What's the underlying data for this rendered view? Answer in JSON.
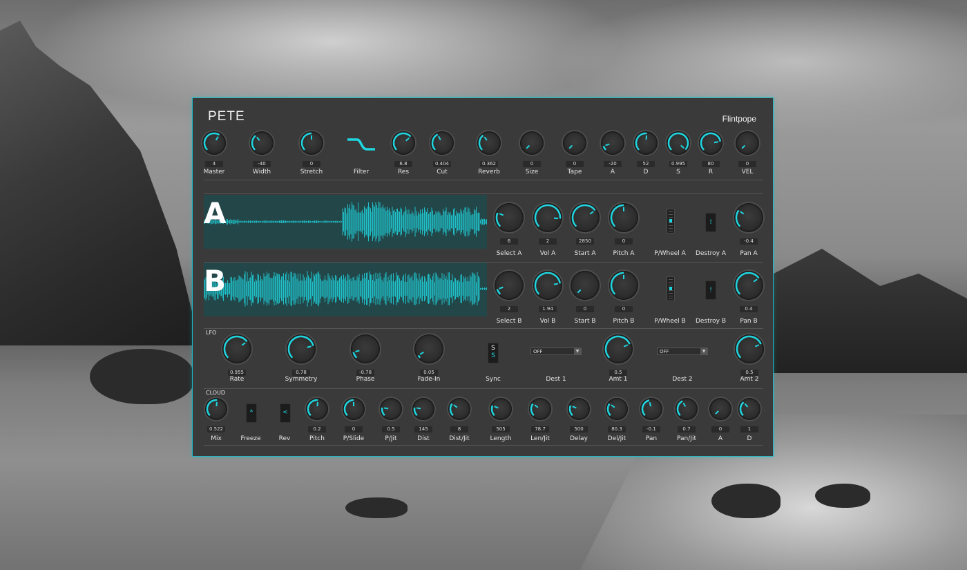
{
  "plugin": {
    "name": "PETE",
    "brand": "Flintpope"
  },
  "colors": {
    "accent": "#1fd6e0",
    "panel": "#3a3a3a"
  },
  "main_row": [
    {
      "id": "master",
      "label": "Master",
      "value": "4",
      "level": 0.62
    },
    {
      "id": "width",
      "label": "Width",
      "value": "-40",
      "level": 0.35
    },
    {
      "id": "stretch",
      "label": "Stretch",
      "value": "0",
      "level": 0.5
    },
    {
      "id": "filter",
      "label": "Filter",
      "value": "",
      "icon": "filter-curve-icon"
    },
    {
      "id": "res",
      "label": "Res",
      "value": "6.8",
      "level": 0.68
    },
    {
      "id": "cut",
      "label": "Cut",
      "value": "0.404",
      "level": 0.4
    },
    {
      "id": "reverb",
      "label": "Reverb",
      "value": "0.362",
      "level": 0.36
    },
    {
      "id": "size",
      "label": "Size",
      "value": "0",
      "level": 0.0
    },
    {
      "id": "tape",
      "label": "Tape",
      "value": "0",
      "level": 0.0
    },
    {
      "id": "a",
      "label": "A",
      "value": "-20",
      "level": 0.1
    },
    {
      "id": "d",
      "label": "D",
      "value": "52",
      "level": 0.52
    },
    {
      "id": "s",
      "label": "S",
      "value": "0.995",
      "level": 0.99
    },
    {
      "id": "r",
      "label": "R",
      "value": "80",
      "level": 0.8
    },
    {
      "id": "vel",
      "label": "VEL",
      "value": "0",
      "level": 0.0
    }
  ],
  "osc_a": {
    "letter": "A",
    "knobs": [
      {
        "label": "Select A",
        "value": "6",
        "level": 0.25
      },
      {
        "label": "Vol A",
        "value": "2",
        "level": 0.85
      },
      {
        "label": "Start  A",
        "value": "2850",
        "level": 0.7
      },
      {
        "label": "Pitch  A",
        "value": "0",
        "level": 0.5
      }
    ],
    "pwheel_label": "P/Wheel A",
    "destroy_label": "Destroy A",
    "destroy_glyph": "!",
    "pan": {
      "label": "Pan A",
      "value": "-0.4",
      "level": 0.3
    }
  },
  "osc_b": {
    "letter": "B",
    "knobs": [
      {
        "label": "Select B",
        "value": "2",
        "level": 0.1
      },
      {
        "label": "Vol B",
        "value": "1.94",
        "level": 0.8
      },
      {
        "label": "Start  B",
        "value": "0",
        "level": 0.0
      },
      {
        "label": "Pitch  B",
        "value": "0",
        "level": 0.5
      }
    ],
    "pwheel_label": "P/Wheel B",
    "destroy_label": "Destroy B",
    "destroy_glyph": "!",
    "pan": {
      "label": "Pan B",
      "value": "0.4",
      "level": 0.7
    }
  },
  "lfo": {
    "section": "LFO",
    "knobs": [
      {
        "label": "Rate",
        "value": "0.955",
        "level": 0.7
      },
      {
        "label": "Symmetry",
        "value": "0.78",
        "level": 0.78
      },
      {
        "label": "Phase",
        "value": "-0.78",
        "level": 0.11
      },
      {
        "label": "Fade-In",
        "value": "0.05",
        "level": 0.05
      }
    ],
    "sync": {
      "label": "Sync",
      "glyph": "S"
    },
    "dest1": {
      "label": "Dest 1",
      "value": "OFF"
    },
    "amt1": {
      "label": "Amt 1",
      "value": "0.5",
      "level": 0.75
    },
    "dest2": {
      "label": "Dest 2",
      "value": "OFF"
    },
    "amt2": {
      "label": "Amt 2",
      "value": "0.5",
      "level": 0.75
    }
  },
  "cloud": {
    "section": "CLOUD",
    "mix": {
      "label": "Mix",
      "value": "0.522",
      "level": 0.52
    },
    "freeze": {
      "label": "Freeze",
      "glyph": "*"
    },
    "rev": {
      "label": "Rev",
      "glyph": "<"
    },
    "knobs": [
      {
        "label": "Pitch",
        "value": "0.2",
        "level": 0.52
      },
      {
        "label": "P/Slide",
        "value": "0",
        "level": 0.5
      },
      {
        "label": "P/Jit",
        "value": "0.5",
        "level": 0.2
      },
      {
        "label": "Dist",
        "value": "145",
        "level": 0.2
      },
      {
        "label": "Dist/Jit",
        "value": "8",
        "level": 0.3
      },
      {
        "label": "Length",
        "value": "505",
        "level": 0.25
      },
      {
        "label": "Len/Jit",
        "value": "78.7",
        "level": 0.3
      },
      {
        "label": "Delay",
        "value": "500",
        "level": 0.25
      },
      {
        "label": "Del/Jit",
        "value": "80.3",
        "level": 0.3
      },
      {
        "label": "Pan",
        "value": "-0.1",
        "level": 0.45
      },
      {
        "label": "Pan/Jit",
        "value": "0.7",
        "level": 0.4
      },
      {
        "label": "A",
        "value": "0",
        "level": 0.0
      },
      {
        "label": "D",
        "value": "1",
        "level": 0.35
      }
    ]
  }
}
